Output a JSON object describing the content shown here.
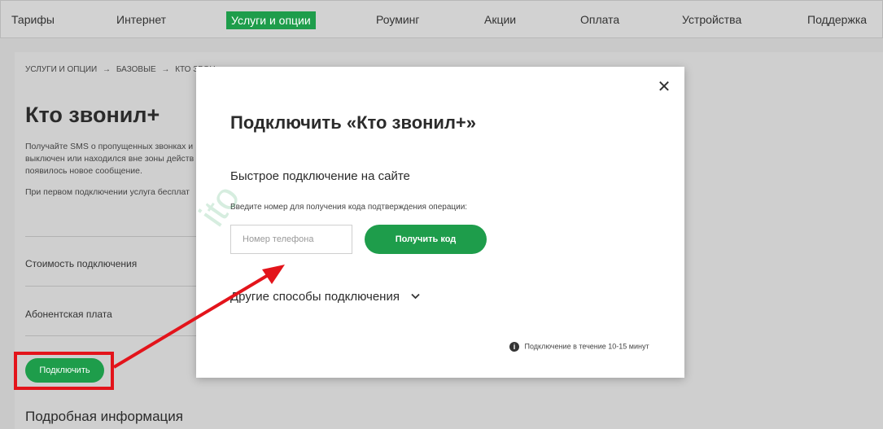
{
  "nav": {
    "items": [
      "Тарифы",
      "Интернет",
      "Услуги и опции",
      "Роуминг",
      "Акции",
      "Оплата",
      "Устройства",
      "Поддержка"
    ],
    "active_index": 2
  },
  "breadcrumb": {
    "items": [
      "Услуги и опции",
      "→",
      "Базовые",
      "→",
      "Кто звон"
    ]
  },
  "page": {
    "title": "Кто звонил+",
    "desc_lines": [
      "Получайте SMS о пропущенных звонках и",
      "выключен или находился вне зоны действ",
      "появилось новое сообщение."
    ],
    "desc2": "При первом подключении услуга бесплат",
    "price_label": "Стоимость подключения",
    "fee_label": "Абонентская плата",
    "connect_label": "Подключить",
    "more_info": "Подробная информация"
  },
  "modal": {
    "close_icon": "close-icon",
    "title": "Подключить «Кто звонил+»",
    "subtitle": "Быстрое подключение на сайте",
    "hint": "Введите номер для получения кода подтверждения операции:",
    "phone_placeholder": "Номер телефона",
    "get_code_label": "Получить код",
    "other_ways": "Другие способы подключения",
    "footnote": "Подключение в течение 10-15 минут"
  },
  "watermark": "ito",
  "colors": {
    "accent": "#1e9d4b",
    "annotation": "#e3141b"
  }
}
